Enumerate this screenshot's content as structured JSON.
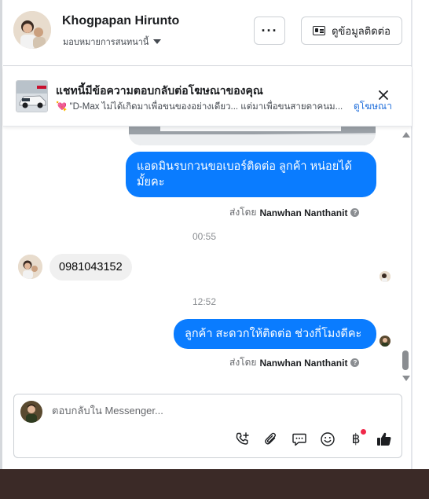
{
  "header": {
    "user_name": "Khogpapan Hirunto",
    "assignment_label": "มอบหมายการสนทนานี้",
    "more_label": "···",
    "contact_info_label": "ดูข้อมูลติดต่อ"
  },
  "ad_banner": {
    "title": "แชทนี้มีข้อความตอบกลับต่อโฆษณาของคุณ",
    "preview_text": "\"D-Max ไม่ได้เกิดมาเพื่อขนของอย่างเดียว... แต่มาเพื่อขนสายตาคนม...",
    "view_ad_label": "ดูโฆษณา"
  },
  "messages": [
    {
      "direction": "out",
      "text": "แอดมินรบกวนขอเบอร์ติดต่อ ลูกค้า  หน่อยได้มั้ยคะ"
    },
    {
      "direction": "out",
      "sent_by_prefix": "ส่งโดย",
      "sent_by_name": "Nanwhan Nanthanit"
    },
    {
      "timestamp": "00:55"
    },
    {
      "direction": "in",
      "text": "0981043152"
    },
    {
      "timestamp": "12:52"
    },
    {
      "direction": "out",
      "text": "ลูกค้า สะดวกให้ติดต่อ ช่วงกี่โมงดีคะ"
    },
    {
      "direction": "out",
      "sent_by_prefix": "ส่งโดย",
      "sent_by_name": "Nanwhan Nanthanit"
    }
  ],
  "composer": {
    "placeholder": "ตอบกลับใน Messenger...",
    "value": ""
  },
  "toolbar_icons": [
    "phone-plus-icon",
    "paperclip-icon",
    "saved-reply-icon",
    "emoji-icon",
    "baht-payment-icon",
    "thumbs-up-icon"
  ],
  "colors": {
    "outgoing_bubble": "#0a7cff",
    "incoming_bubble": "#f0f0f0",
    "link": "#216fdb",
    "notification_dot": "#f02849"
  }
}
